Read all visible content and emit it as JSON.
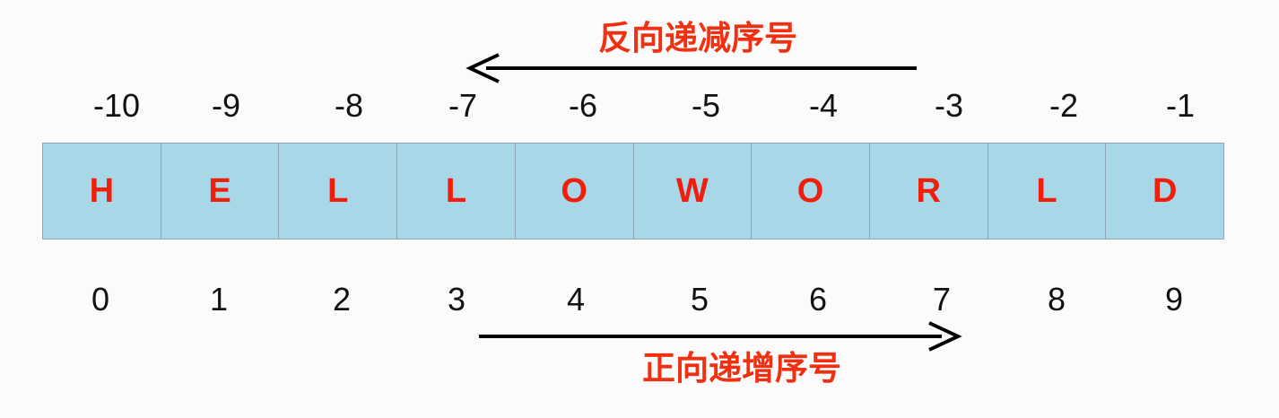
{
  "diagram": {
    "top_caption": "反向递减序号",
    "bottom_caption": "正向递增序号",
    "negative_indices": [
      "-10",
      "-9",
      "-8",
      "-7",
      "-6",
      "-5",
      "-4",
      "-3",
      "-2",
      "-1"
    ],
    "characters": [
      "H",
      "E",
      "L",
      "L",
      "O",
      "W",
      "O",
      "R",
      "L",
      "D"
    ],
    "positive_indices": [
      "0",
      "1",
      "2",
      "3",
      "4",
      "5",
      "6",
      "7",
      "8",
      "9"
    ],
    "colors": {
      "caption": "#f03010",
      "letters": "#f01e0a",
      "cell_fill": "#a8d8e8",
      "cell_border": "#8aa7b3",
      "arrow": "#000000",
      "index_text": "#111111"
    }
  }
}
